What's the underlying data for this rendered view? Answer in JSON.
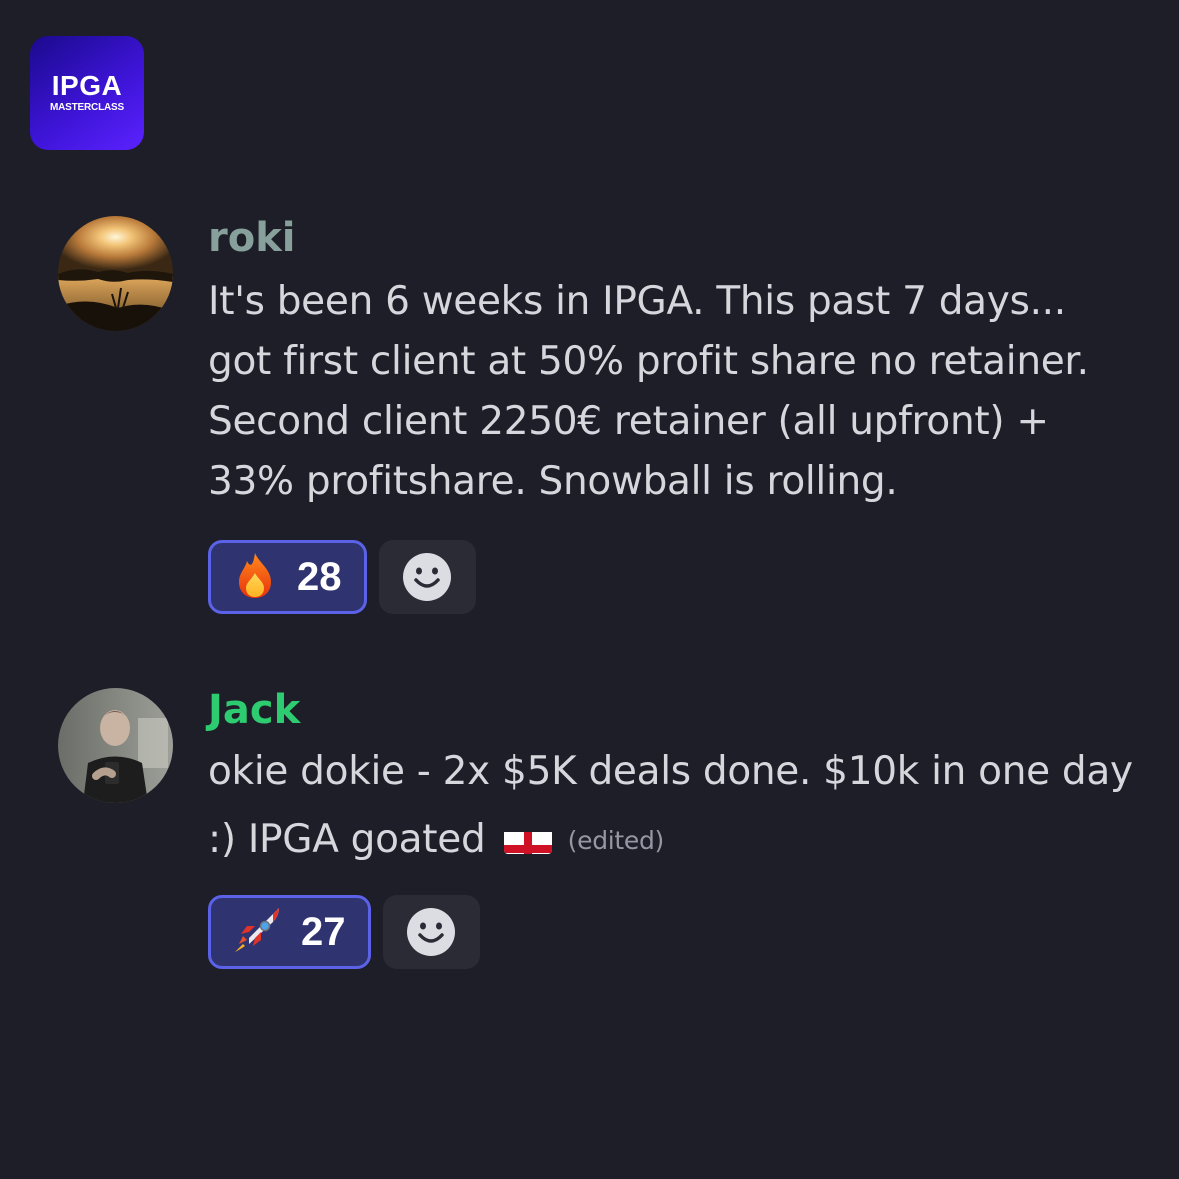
{
  "logo": {
    "title": "IPGA",
    "subtitle": "MASTERCLASS"
  },
  "messages": [
    {
      "username": "roki",
      "username_color": "#87a09b",
      "text_lines": [
        "It's been 6 weeks in IPGA. This past 7 days...",
        "got first client at 50% profit share no retainer.",
        "Second client 2250€ retainer (all upfront) +",
        "33% profitshare. Snowball is rolling."
      ],
      "reaction": {
        "emoji": "fire",
        "count": "28"
      }
    },
    {
      "username": "Jack",
      "username_color": "#2ecc71",
      "text_lines": [
        "okie dokie - 2x $5K deals done. $10k in one day",
        ":) IPGA goated"
      ],
      "flag": "england-flag",
      "edited_label": "(edited)",
      "reaction": {
        "emoji": "rocket",
        "count": "27"
      }
    }
  ],
  "colors": {
    "background": "#1d1e27",
    "reaction_active_bg": "#2f3370",
    "reaction_active_border": "#5b62e8",
    "text": "#d6d7dd"
  }
}
